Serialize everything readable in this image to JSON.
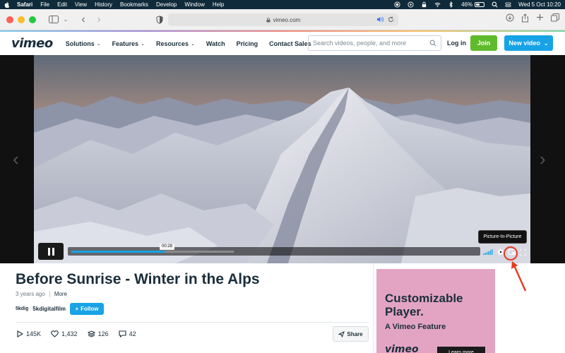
{
  "menubar": {
    "items": [
      "Safari",
      "File",
      "Edit",
      "View",
      "History",
      "Bookmarks",
      "Develop",
      "Window",
      "Help"
    ],
    "battery": "46%",
    "battery_level": 0.46,
    "clock": "Wed 5 Oct  10:20"
  },
  "browser": {
    "url": "vimeo.com"
  },
  "nav": {
    "logo": "vimeo",
    "links": [
      {
        "label": "Solutions",
        "dropdown": true
      },
      {
        "label": "Features",
        "dropdown": true
      },
      {
        "label": "Resources",
        "dropdown": true
      },
      {
        "label": "Watch",
        "dropdown": false
      },
      {
        "label": "Pricing",
        "dropdown": false
      },
      {
        "label": "Contact Sales",
        "dropdown": false
      }
    ],
    "search_placeholder": "Search videos, people, and more",
    "login": "Log in",
    "join": "Join",
    "new_video": "New video"
  },
  "player": {
    "time": "00:28",
    "played_fraction": 0.23,
    "buffered_fraction": 0.4,
    "tooltip": "Picture-In-Picture"
  },
  "video": {
    "title": "Before Sunrise - Winter in the Alps",
    "age": "3 years ago",
    "more": "More",
    "owner_avatar": "5kdig",
    "owner_name": "5kdigitalfilm",
    "follow": "Follow",
    "stats": {
      "plays": "145K",
      "likes": "1,432",
      "collections": "126",
      "comments": "42"
    },
    "share": "Share"
  },
  "ad": {
    "headline_line1": "Customizable",
    "headline_line2": "Player.",
    "subline": "A Vimeo Feature",
    "logo": "vimeo",
    "cta": "Learn more"
  },
  "colors": {
    "menubar": "#0f2a3a",
    "vimeo_blue": "#17a3e6",
    "join_green": "#5fbb2b",
    "ad_pink": "#e3a4c4",
    "annotation_red": "#e63a1f"
  }
}
